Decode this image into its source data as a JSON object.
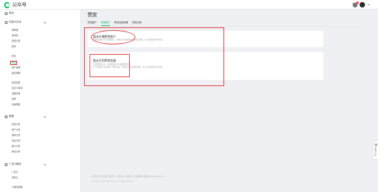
{
  "app": {
    "name": "公众号"
  },
  "sidebar": {
    "home": "首页",
    "groups": {
      "content": "内容与互动",
      "data": "数据",
      "ads": "广告与服务"
    },
    "items": {
      "drafts": "草稿箱",
      "materials": "素材库",
      "publish_records": "发表记录",
      "originals": "原创",
      "chat": "私信",
      "likes": "赞赏",
      "user_management": "用户管理",
      "messages": "消息",
      "message_management": "留言管理",
      "auto_reply": "自动回复",
      "custom_menu": "自定义菜单",
      "sub_accounts": "话题标签",
      "vote": "投票",
      "frequently_asked": "页面模板",
      "content_analysis": "内容分析",
      "user_analysis": "用户分析",
      "menu_analysis": "菜单分析",
      "message_analysis": "消息分析",
      "interface_analysis": "接口分析",
      "web_analysis": "网页分析",
      "ad_main": "广告主",
      "traffic_main": "流量主",
      "mini_program": "小程序管理"
    }
  },
  "main": {
    "page_title": "赞赏",
    "tabs": [
      "赞赏账户",
      "赞赏账户",
      "赞赏功能设置",
      "赞赏记录"
    ],
    "active_tab": 1,
    "card1": {
      "title": "暂未开通赞赏账户",
      "desc": "开通赞赏账户可以接收赞赏，开通后方可在文章中使用赞赏功能，可以在赞赏账户中查看。"
    },
    "card2": {
      "title": "暂无可用赞赏武器",
      "desc_line1": "开通赞赏账户后，可在赞赏账户中设置赞赏武器",
      "desc_line2": "每个赞赏账户可设置多个赞赏武器，开通后可以在文章中使用，也可以在赞赏账户中查看"
    }
  },
  "footer": {
    "links": "关于腾讯 | 服务协议 | 运营中心 | 辟谣中心 | 客服中心 | 联系邮箱 | 侵权投诉 weixin.qq.com",
    "copyright": "Copyright © 2012-2024 Tencent. All Rights Reserved."
  },
  "float_widget": {
    "label": "遇到问题"
  },
  "colors": {
    "accent": "#07c160",
    "annotation": "#e0393e"
  }
}
